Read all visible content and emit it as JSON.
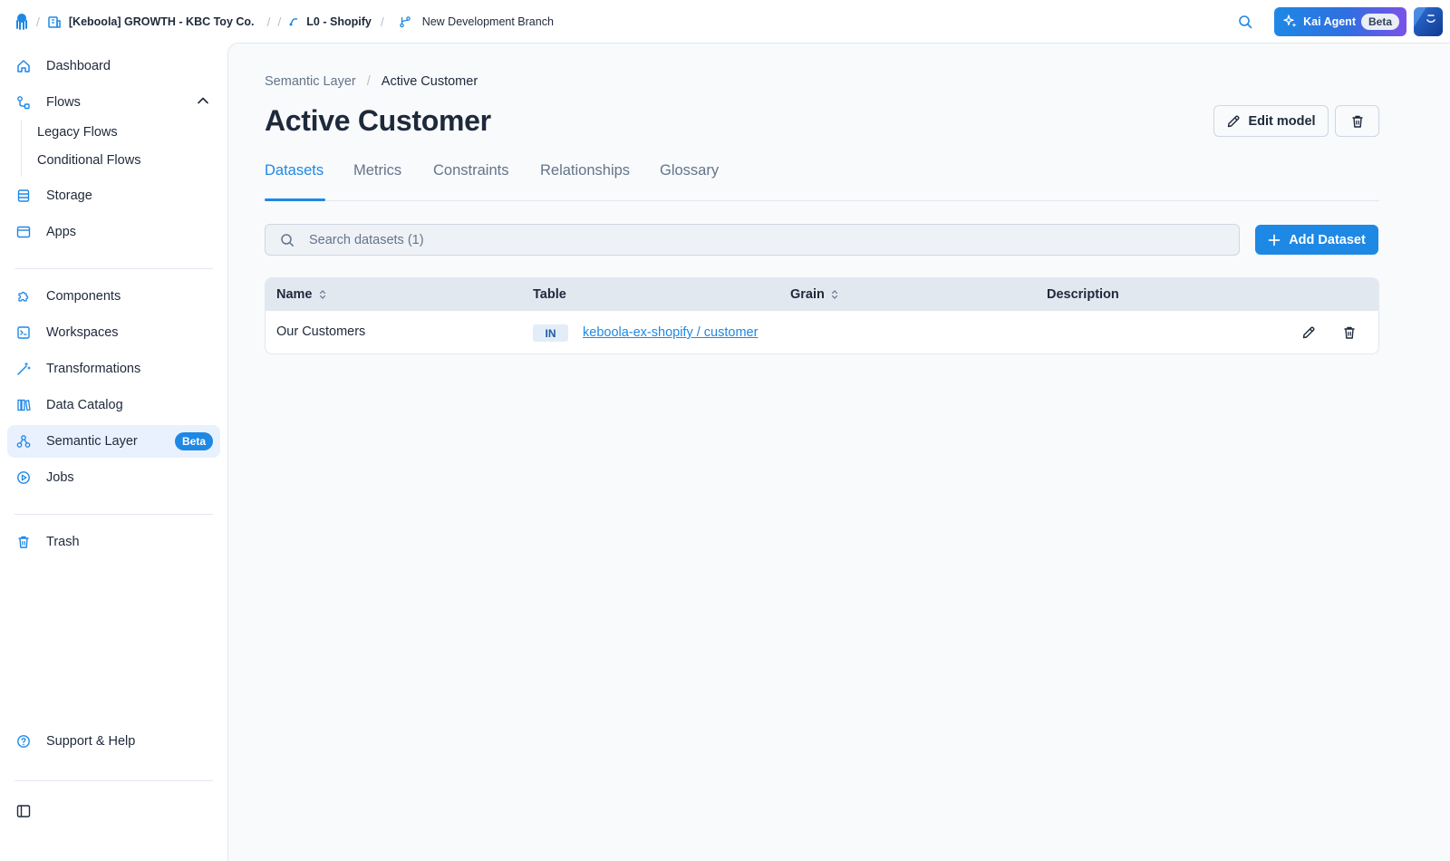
{
  "topbar": {
    "project": "[Keboola] GROWTH - KBC Toy Co.",
    "flow": "L0 - Shopify",
    "branch": "New Development Branch",
    "kai_label": "Kai Agent",
    "kai_badge": "Beta"
  },
  "sidebar": {
    "items": [
      {
        "label": "Dashboard",
        "icon": "home-icon"
      },
      {
        "label": "Flows",
        "icon": "flows-icon"
      },
      {
        "label": "Storage",
        "icon": "storage-icon"
      },
      {
        "label": "Apps",
        "icon": "apps-icon"
      },
      {
        "label": "Components",
        "icon": "puzzle-icon"
      },
      {
        "label": "Workspaces",
        "icon": "workspace-icon"
      },
      {
        "label": "Transformations",
        "icon": "wand-icon"
      },
      {
        "label": "Data Catalog",
        "icon": "catalog-icon"
      },
      {
        "label": "Semantic Layer",
        "icon": "semantic-icon",
        "badge": "Beta"
      },
      {
        "label": "Jobs",
        "icon": "jobs-icon"
      },
      {
        "label": "Trash",
        "icon": "trash-icon"
      },
      {
        "label": "Support & Help",
        "icon": "help-icon"
      }
    ],
    "flows_sub": [
      "Legacy Flows",
      "Conditional Flows"
    ]
  },
  "main": {
    "breadcrumb": {
      "parent": "Semantic Layer",
      "separator": "/",
      "current": "Active Customer"
    },
    "title": "Active Customer",
    "edit_label": "Edit model",
    "tabs": [
      "Datasets",
      "Metrics",
      "Constraints",
      "Relationships",
      "Glossary"
    ],
    "active_tab": "Datasets",
    "search_placeholder": "Search datasets (1)",
    "add_label": "Add Dataset",
    "table": {
      "headers": [
        "Name",
        "Table",
        "Grain",
        "Description"
      ],
      "rows": [
        {
          "name": "Our Customers",
          "stage": "IN",
          "table": "keboola-ex-shopify / customer",
          "grain": "",
          "description": ""
        }
      ]
    }
  },
  "colors": {
    "accent": "#1e88e5",
    "active_bg": "#e8f1fd"
  }
}
